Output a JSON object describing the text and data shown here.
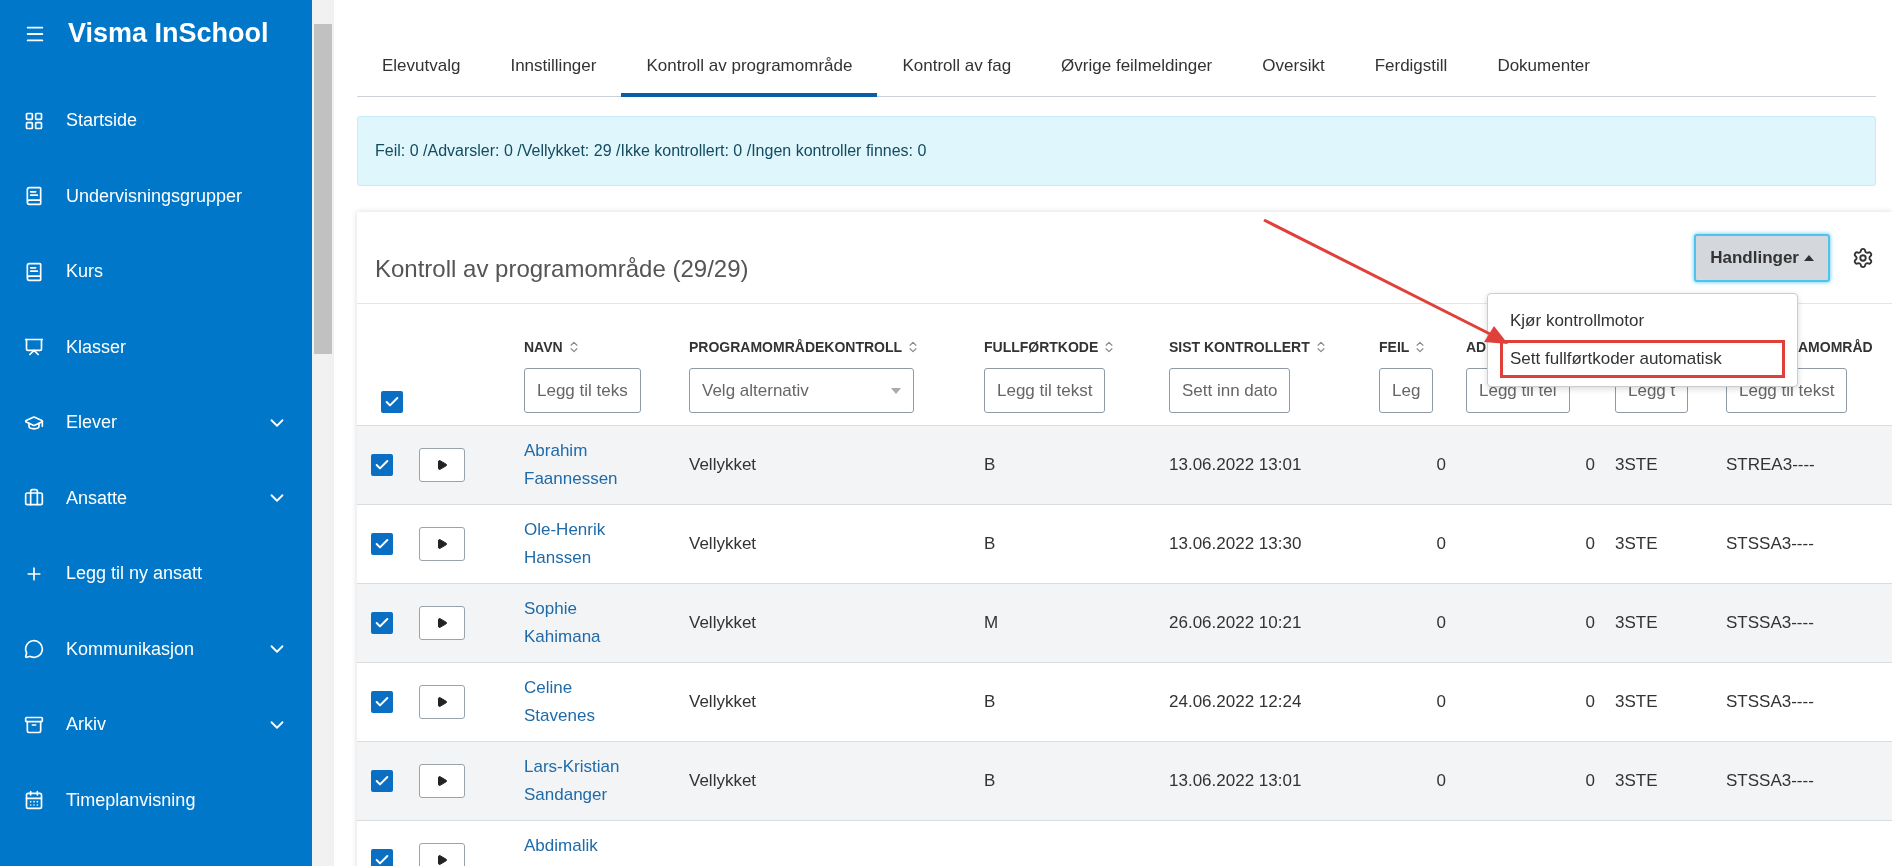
{
  "sidebar": {
    "title": "Visma InSchool",
    "items": [
      {
        "label": "Startside",
        "expandable": false
      },
      {
        "label": "Undervisningsgrupper",
        "expandable": false
      },
      {
        "label": "Kurs",
        "expandable": false
      },
      {
        "label": "Klasser",
        "expandable": false
      },
      {
        "label": "Elever",
        "expandable": true
      },
      {
        "label": "Ansatte",
        "expandable": true
      },
      {
        "label": "Legg til ny ansatt",
        "expandable": false
      },
      {
        "label": "Kommunikasjon",
        "expandable": true
      },
      {
        "label": "Arkiv",
        "expandable": true
      },
      {
        "label": "Timeplanvisning",
        "expandable": false
      }
    ]
  },
  "tabs": [
    {
      "label": "Elevutvalg",
      "selected": false
    },
    {
      "label": "Innstillinger",
      "selected": false
    },
    {
      "label": "Kontroll av programområde",
      "selected": true
    },
    {
      "label": "Kontroll av fag",
      "selected": false
    },
    {
      "label": "Øvrige feilmeldinger",
      "selected": false
    },
    {
      "label": "Oversikt",
      "selected": false
    },
    {
      "label": "Ferdigstill",
      "selected": false
    },
    {
      "label": "Dokumenter",
      "selected": false
    }
  ],
  "alert": "Feil: 0 /Advarsler: 0 /Vellykket: 29 /Ikke kontrollert: 0 /Ingen kontroller finnes: 0",
  "card": {
    "title": "Kontroll av programområde (29/29)",
    "actions_button": "Handlinger",
    "menu": [
      {
        "label": "Kjør kontrollmotor",
        "highlighted": false
      },
      {
        "label": "Sett fullførtkoder automatisk",
        "highlighted": true
      }
    ]
  },
  "table": {
    "select_all": true,
    "columns": [
      {
        "header": "NAVN",
        "filter": {
          "kind": "text",
          "placeholder": "Legg til teks"
        }
      },
      {
        "header": "PROGRAMOMRÅDEKONTROLL",
        "filter": {
          "kind": "select",
          "placeholder": "Velg alternativ"
        }
      },
      {
        "header": "FULLFØRTKODE",
        "filter": {
          "kind": "text",
          "placeholder": "Legg til tekst"
        }
      },
      {
        "header": "SIST KONTROLLERT",
        "filter": {
          "kind": "text",
          "placeholder": "Sett inn dato"
        }
      },
      {
        "header": "FEIL",
        "filter": {
          "kind": "text",
          "placeholder": "Leg"
        }
      },
      {
        "header": "AD",
        "filter": {
          "kind": "text",
          "placeholder": "Legg til tel"
        }
      },
      {
        "filter": {
          "kind": "text",
          "placeholder": "Legg t"
        }
      },
      {
        "header": "AMOMRÅD",
        "filter": {
          "kind": "text",
          "placeholder": "Legg til tekst"
        }
      }
    ],
    "rows": [
      {
        "checked": true,
        "cells": [
          "Abrahim Faannessen",
          "Vellykket",
          "B",
          "13.06.2022 13:01",
          "0",
          "0",
          "3STE",
          "STREA3----"
        ]
      },
      {
        "checked": true,
        "cells": [
          "Ole-Henrik Hanssen",
          "Vellykket",
          "B",
          "13.06.2022 13:30",
          "0",
          "0",
          "3STE",
          "STSSA3----"
        ]
      },
      {
        "checked": true,
        "cells": [
          "Sophie Kahimana",
          "Vellykket",
          "M",
          "26.06.2022 10:21",
          "0",
          "0",
          "3STE",
          "STSSA3----"
        ]
      },
      {
        "checked": true,
        "cells": [
          "Celine Stavenes",
          "Vellykket",
          "B",
          "24.06.2022 12:24",
          "0",
          "0",
          "3STE",
          "STSSA3----"
        ]
      },
      {
        "checked": true,
        "cells": [
          "Lars-Kristian Sandanger",
          "Vellykket",
          "B",
          "13.06.2022 13:01",
          "0",
          "0",
          "3STE",
          "STSSA3----"
        ]
      },
      {
        "checked": true,
        "cells": [
          "Abdimalik"
        ]
      }
    ]
  }
}
